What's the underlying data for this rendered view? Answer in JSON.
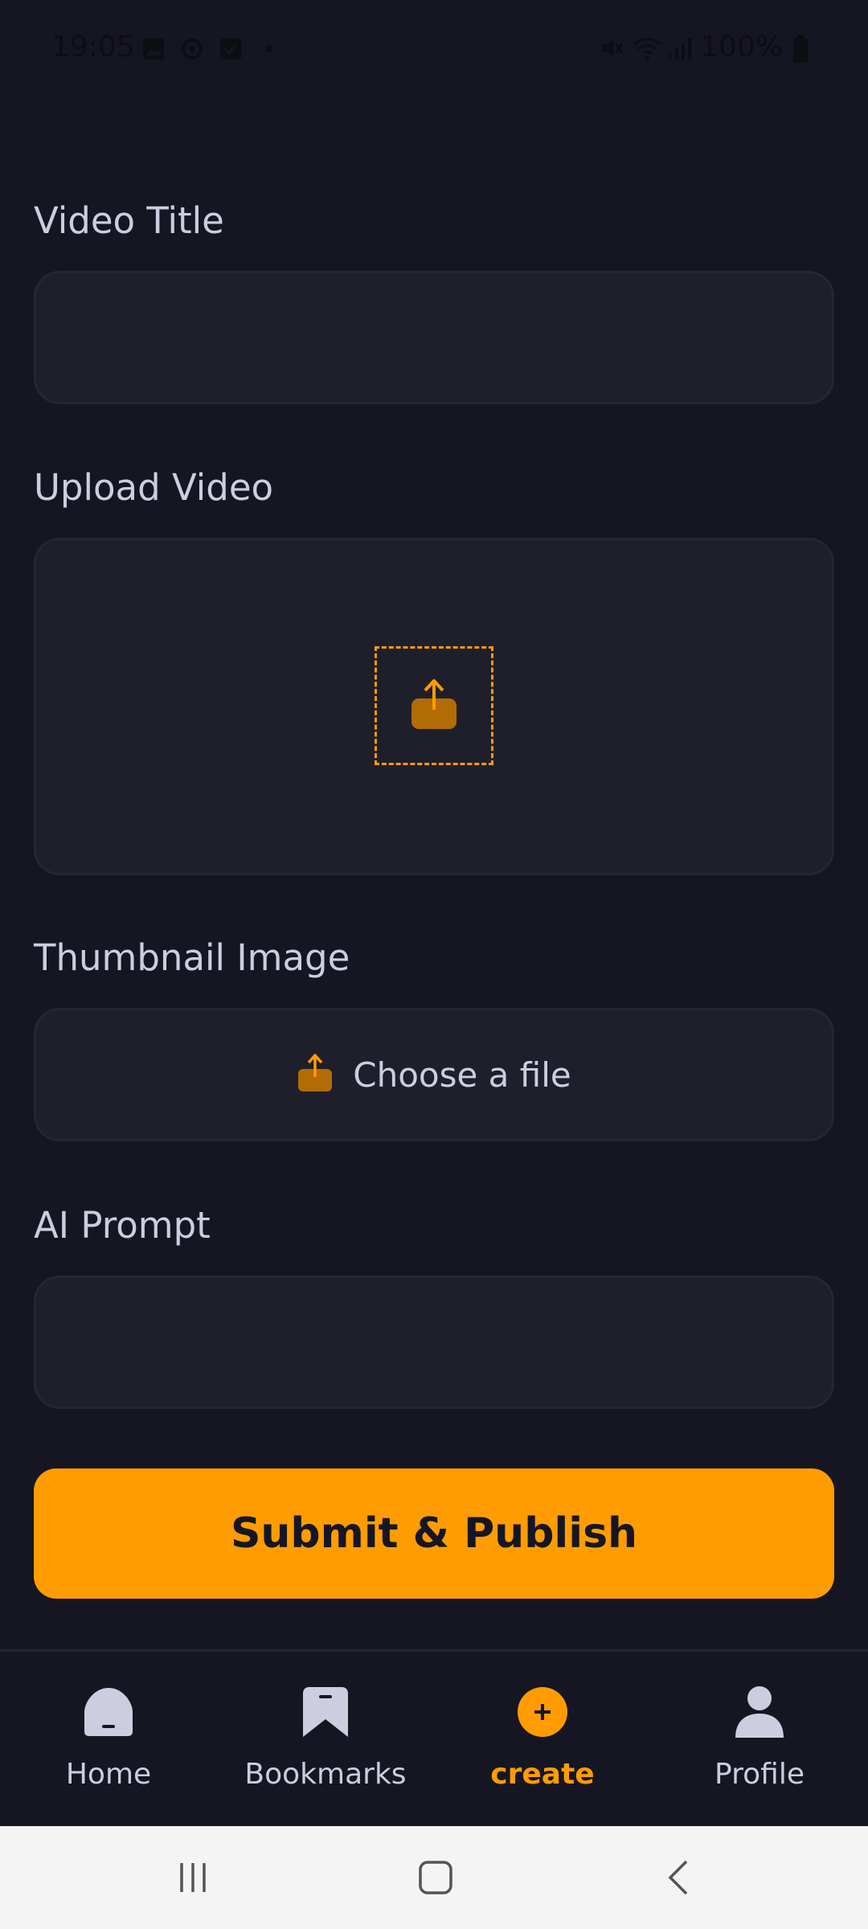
{
  "status_bar": {
    "time": "19:05",
    "battery": "100%",
    "icons_left": [
      "image-icon",
      "sync-icon",
      "check-box-icon",
      "dot-icon"
    ],
    "icons_right": [
      "mute-icon",
      "wifi-icon",
      "signal-icon",
      "battery-icon"
    ]
  },
  "form": {
    "title_label": "Video Title",
    "title_value": "",
    "video_label": "Upload Video",
    "thumbnail_label": "Thumbnail Image",
    "thumbnail_button": "Choose a file",
    "prompt_label": "AI Prompt",
    "prompt_value": "",
    "submit_label": "Submit & Publish"
  },
  "bottom_nav": {
    "items": [
      {
        "label": "Home",
        "icon": "home-icon",
        "active": false
      },
      {
        "label": "Bookmarks",
        "icon": "bookmark-icon",
        "active": false
      },
      {
        "label": "create",
        "icon": "plus-icon",
        "active": true
      },
      {
        "label": "Profile",
        "icon": "profile-icon",
        "active": false
      }
    ]
  },
  "colors": {
    "background": "#161622",
    "field": "#1f1f2b",
    "accent": "#ff9c01",
    "text": "#cdcde0"
  }
}
